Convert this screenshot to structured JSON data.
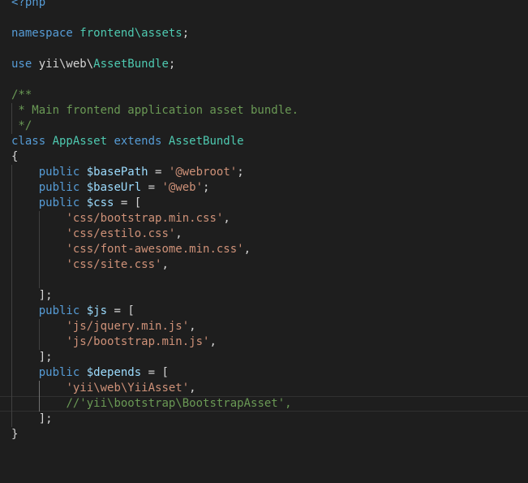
{
  "editor": {
    "language": "php",
    "current_line": 26,
    "colors": {
      "background": "#1e1e1e",
      "kw": "#569cd6",
      "cls": "#4ec9b0",
      "str": "#ce9178",
      "com": "#6a9955",
      "var": "#9cdcfe",
      "txt": "#d4d4d4"
    },
    "lines": [
      [
        [
          "<?php",
          "kw"
        ]
      ],
      [],
      [
        [
          "namespace ",
          "kw"
        ],
        [
          "frontend\\assets",
          "cls"
        ],
        [
          ";",
          "txt"
        ]
      ],
      [],
      [
        [
          "use ",
          "kw"
        ],
        [
          "yii\\web\\",
          "txt"
        ],
        [
          "AssetBundle",
          "cls"
        ],
        [
          ";",
          "txt"
        ]
      ],
      [],
      [
        [
          "/**",
          "com"
        ]
      ],
      [
        [
          " * Main frontend application asset bundle.",
          "com"
        ]
      ],
      [
        [
          " */",
          "com"
        ]
      ],
      [
        [
          "class ",
          "kw"
        ],
        [
          "AppAsset ",
          "cls"
        ],
        [
          "extends ",
          "kw"
        ],
        [
          "AssetBundle",
          "cls"
        ]
      ],
      [
        [
          "{",
          "txt"
        ]
      ],
      [
        [
          "    ",
          "txt"
        ],
        [
          "public ",
          "kw"
        ],
        [
          "$basePath",
          "var"
        ],
        [
          " = ",
          "txt"
        ],
        [
          "'@webroot'",
          "str"
        ],
        [
          ";",
          "txt"
        ]
      ],
      [
        [
          "    ",
          "txt"
        ],
        [
          "public ",
          "kw"
        ],
        [
          "$baseUrl",
          "var"
        ],
        [
          " = ",
          "txt"
        ],
        [
          "'@web'",
          "str"
        ],
        [
          ";",
          "txt"
        ]
      ],
      [
        [
          "    ",
          "txt"
        ],
        [
          "public ",
          "kw"
        ],
        [
          "$css",
          "var"
        ],
        [
          " = [",
          "txt"
        ]
      ],
      [
        [
          "        ",
          "txt"
        ],
        [
          "'css/bootstrap.min.css'",
          "str"
        ],
        [
          ",",
          "txt"
        ]
      ],
      [
        [
          "        ",
          "txt"
        ],
        [
          "'css/estilo.css'",
          "str"
        ],
        [
          ",",
          "txt"
        ]
      ],
      [
        [
          "        ",
          "txt"
        ],
        [
          "'css/font-awesome.min.css'",
          "str"
        ],
        [
          ",",
          "txt"
        ]
      ],
      [
        [
          "        ",
          "txt"
        ],
        [
          "'css/site.css'",
          "str"
        ],
        [
          ",",
          "txt"
        ]
      ],
      [],
      [
        [
          "    ",
          "txt"
        ],
        [
          "];",
          "txt"
        ]
      ],
      [
        [
          "    ",
          "txt"
        ],
        [
          "public ",
          "kw"
        ],
        [
          "$js",
          "var"
        ],
        [
          " = [",
          "txt"
        ]
      ],
      [
        [
          "        ",
          "txt"
        ],
        [
          "'js/jquery.min.js'",
          "str"
        ],
        [
          ",",
          "txt"
        ]
      ],
      [
        [
          "        ",
          "txt"
        ],
        [
          "'js/bootstrap.min.js'",
          "str"
        ],
        [
          ",",
          "txt"
        ]
      ],
      [
        [
          "    ",
          "txt"
        ],
        [
          "];",
          "txt"
        ]
      ],
      [
        [
          "    ",
          "txt"
        ],
        [
          "public ",
          "kw"
        ],
        [
          "$depends",
          "var"
        ],
        [
          " = [",
          "txt"
        ]
      ],
      [
        [
          "        ",
          "txt"
        ],
        [
          "'yii\\web\\YiiAsset'",
          "str"
        ],
        [
          ",",
          "txt"
        ]
      ],
      [
        [
          "        ",
          "txt"
        ],
        [
          "//'yii\\bootstrap\\BootstrapAsset',",
          "com"
        ]
      ],
      [
        [
          "    ",
          "txt"
        ],
        [
          "];",
          "txt"
        ]
      ],
      [
        [
          "}",
          "txt"
        ]
      ]
    ]
  }
}
